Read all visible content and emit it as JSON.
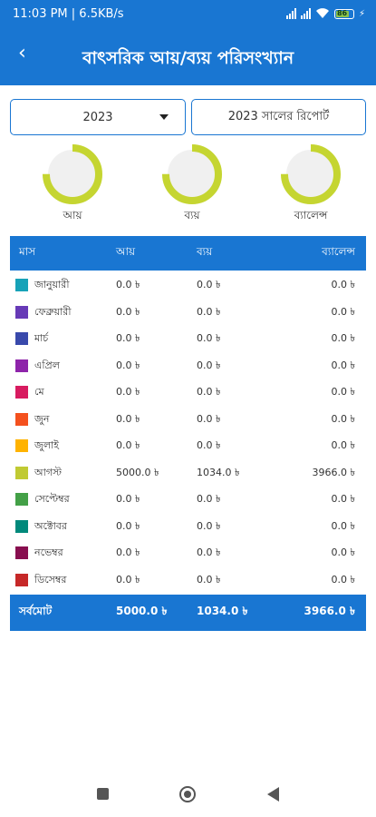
{
  "status_bar": {
    "time": "11:03 PM | 6.5KB/s",
    "battery": "86"
  },
  "app_bar": {
    "back_icon": "arrow-back-icon",
    "title": "বাৎসরিক আয়/ব্যয় পরিসংখ্যান"
  },
  "controls": {
    "year_value": "2023",
    "report_button": "2023 সালের রিপোর্ট"
  },
  "gauges": [
    {
      "label": "আয়",
      "fill": 0.75
    },
    {
      "label": "ব্যয়",
      "fill": 0.75
    },
    {
      "label": "ব্যালেন্স",
      "fill": 0.75
    }
  ],
  "colors": {
    "primary": "#1976d2",
    "gauge_ring": "#c5d531",
    "gauge_track": "#f0f0f0"
  },
  "table": {
    "headers": {
      "month": "মাস",
      "income": "আয়",
      "expense": "ব্যয়",
      "balance": "ব্যালেন্স"
    },
    "rows": [
      {
        "month": "জানুয়ারী",
        "color": "#17a2b8",
        "income": "0.0 ৳",
        "expense": "0.0 ৳",
        "balance": "0.0 ৳"
      },
      {
        "month": "ফেব্রুয়ারী",
        "color": "#673ab7",
        "income": "0.0 ৳",
        "expense": "0.0 ৳",
        "balance": "0.0 ৳"
      },
      {
        "month": "মার্চ",
        "color": "#3949ab",
        "income": "0.0 ৳",
        "expense": "0.0 ৳",
        "balance": "0.0 ৳"
      },
      {
        "month": "এপ্রিল",
        "color": "#8e24aa",
        "income": "0.0 ৳",
        "expense": "0.0 ৳",
        "balance": "0.0 ৳"
      },
      {
        "month": "মে",
        "color": "#d81b60",
        "income": "0.0 ৳",
        "expense": "0.0 ৳",
        "balance": "0.0 ৳"
      },
      {
        "month": "জুন",
        "color": "#f4511e",
        "income": "0.0 ৳",
        "expense": "0.0 ৳",
        "balance": "0.0 ৳"
      },
      {
        "month": "জুলাই",
        "color": "#ffb300",
        "income": "0.0 ৳",
        "expense": "0.0 ৳",
        "balance": "0.0 ৳"
      },
      {
        "month": "আগস্ট",
        "color": "#c0ca33",
        "income": "5000.0 ৳",
        "expense": "1034.0 ৳",
        "balance": "3966.0 ৳"
      },
      {
        "month": "সেপ্টেম্বর",
        "color": "#43a047",
        "income": "0.0 ৳",
        "expense": "0.0 ৳",
        "balance": "0.0 ৳"
      },
      {
        "month": "অক্টোবর",
        "color": "#00897b",
        "income": "0.0 ৳",
        "expense": "0.0 ৳",
        "balance": "0.0 ৳"
      },
      {
        "month": "নভেম্বর",
        "color": "#880e4f",
        "income": "0.0 ৳",
        "expense": "0.0 ৳",
        "balance": "0.0 ৳"
      },
      {
        "month": "ডিসেম্বর",
        "color": "#c62828",
        "income": "0.0 ৳",
        "expense": "0.0 ৳",
        "balance": "0.0 ৳"
      }
    ],
    "total": {
      "label": "সর্বমোট",
      "income": "5000.0 ৳",
      "expense": "1034.0 ৳",
      "balance": "3966.0 ৳"
    }
  },
  "nav_bar": {
    "recents_icon": "square-recents-icon",
    "home_icon": "circle-home-icon",
    "back_icon": "triangle-back-icon"
  }
}
